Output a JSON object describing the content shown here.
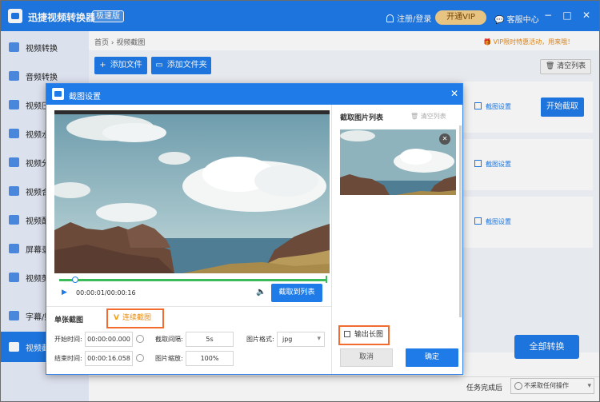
{
  "app": {
    "title": "迅捷视频转换器",
    "badge": "极速版",
    "login": "注册/登录",
    "vip": "开通VIP",
    "help": "客服中心",
    "minimize": "−",
    "maximize": "□",
    "close": "✕"
  },
  "sidebar": {
    "items": [
      {
        "label": "视频转换"
      },
      {
        "label": "音频转换"
      },
      {
        "label": "视频压缩"
      },
      {
        "label": "视频水印"
      },
      {
        "label": "视频分割"
      },
      {
        "label": "视频合并"
      },
      {
        "label": "视频配乐"
      },
      {
        "label": "屏幕录像"
      },
      {
        "label": "视频剪辑"
      },
      {
        "label": "字幕/贴图"
      },
      {
        "label": "视频截图"
      }
    ]
  },
  "main": {
    "breadcrumb": "首页 › 视频截图",
    "promo": "VIP限时特惠活动，用来哦！",
    "add_file": "添加文件",
    "add_folder": "添加文件夹",
    "clear_list": "清空列表",
    "crop_settings": "截图设置",
    "start_crop": "开始截取",
    "convert_all": "全部转换",
    "task_done": "任务完成后",
    "no_action": "不采取任何操作"
  },
  "dialog": {
    "title": "截图设置",
    "close": "✕",
    "time_display": "00:00:01/00:00:16",
    "capture_to_list": "截取到列表",
    "mode_single": "单张截图",
    "mode_continuous": "连续截图",
    "start_time_label": "开始时间:",
    "start_time_value": "00:00:00.000",
    "end_time_label": "结束时间:",
    "end_time_value": "00:00:16.058",
    "interval_label": "截取间隔:",
    "interval_value": "5s",
    "scale_label": "图片缩放:",
    "scale_value": "100%",
    "format_label": "图片格式:",
    "format_value": "jpg",
    "list_title": "截取图片列表",
    "list_clear": "清空列表",
    "output_long": "输出长图",
    "cancel": "取消",
    "ok": "确定",
    "progress": 0.06
  },
  "colors": {
    "accent": "#1f7be8",
    "vip": "#f5cf8a",
    "highlight": "#f26c2f",
    "progress": "#3cbb5a"
  }
}
